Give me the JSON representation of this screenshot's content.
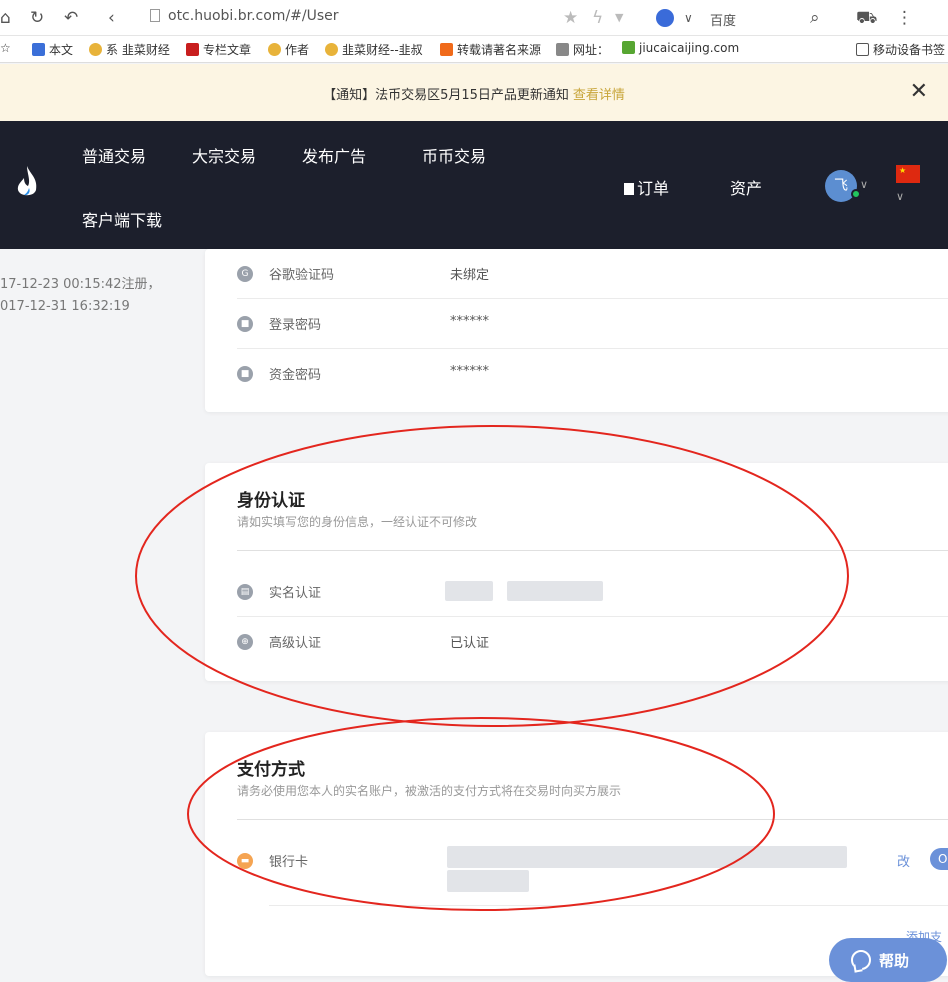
{
  "browser": {
    "url": "otc.huobi.br.com/#/User",
    "search_engine": "百度"
  },
  "bookmarks": [
    "本文",
    "系 韭菜财经",
    "专栏文章",
    "作者",
    "韭菜财经--韭叔",
    "转载请著名来源",
    "网址：",
    "jiucaicaijing.com",
    "移动设备书签"
  ],
  "notice": {
    "prefix": "【通知】",
    "text": "法币交易区5月15日产品更新通知",
    "link": "查看详情"
  },
  "nav": {
    "items": [
      "普通交易",
      "大宗交易",
      "发布广告",
      "币币交易",
      "客户端下载"
    ],
    "orders": "订单",
    "assets": "资产",
    "avatar_letter": "飞"
  },
  "account_info": {
    "registered": "17-12-23 00:15:42注册，",
    "last_login": "017-12-31 16:32:19"
  },
  "security": [
    {
      "label": "谷歌验证码",
      "value": "未绑定",
      "icon": "google-icon"
    },
    {
      "label": "登录密码",
      "value": "******",
      "icon": "lock-icon"
    },
    {
      "label": "资金密码",
      "value": "******",
      "icon": "lock-icon"
    }
  ],
  "identity": {
    "title": "身份认证",
    "subtitle": "请如实填写您的身份信息，一经认证不可修改",
    "real_name_label": "实名认证",
    "advanced_label": "高级认证",
    "advanced_value": "已认证"
  },
  "payment": {
    "title": "支付方式",
    "subtitle": "请务必使用您本人的实名账户，被激活的支付方式将在交易时向买方展示",
    "bank_label": "银行卡",
    "edit": "改",
    "toggle": "O",
    "add": "添加支"
  },
  "help": "帮助"
}
